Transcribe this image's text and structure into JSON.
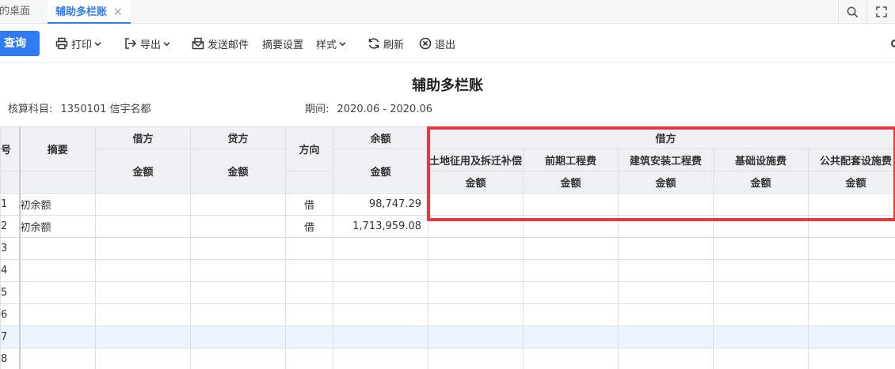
{
  "tabs": {
    "desktop": "我的桌面",
    "active": "辅助多栏账",
    "close": "×"
  },
  "toolbar": {
    "query": "查询",
    "print": "打印",
    "export": "导出",
    "send_mail": "发送邮件",
    "summary_settings": "摘要设置",
    "style": "样式",
    "refresh": "刷新",
    "exit": "退出"
  },
  "report": {
    "title": "辅助多栏账",
    "account_label": "核算科目:",
    "account_value": "1350101 信宇名都",
    "period_label": "期间:",
    "period_value": "2020.06 - 2020.06"
  },
  "table": {
    "headers": {
      "row_no": "号",
      "summary": "摘要",
      "debit": "借方",
      "credit": "贷方",
      "direction": "方向",
      "balance": "余额",
      "amount": "金额",
      "debit_group": "借方",
      "sub_columns": [
        "土地征用及拆迁补偿",
        "前期工程费",
        "建筑安装工程费",
        "基础设施费",
        "公共配套设施费"
      ]
    },
    "rows": [
      {
        "no": "1",
        "summary": "初余额",
        "debit": "",
        "credit": "",
        "direction": "借",
        "balance": "98,747.29"
      },
      {
        "no": "2",
        "summary": "初余额",
        "debit": "",
        "credit": "",
        "direction": "借",
        "balance": "1,713,959.08"
      },
      {
        "no": "3",
        "summary": "",
        "debit": "",
        "credit": "",
        "direction": "",
        "balance": ""
      },
      {
        "no": "4",
        "summary": "",
        "debit": "",
        "credit": "",
        "direction": "",
        "balance": ""
      },
      {
        "no": "5",
        "summary": "",
        "debit": "",
        "credit": "",
        "direction": "",
        "balance": ""
      },
      {
        "no": "6",
        "summary": "",
        "debit": "",
        "credit": "",
        "direction": "",
        "balance": ""
      },
      {
        "no": "7",
        "summary": "",
        "debit": "",
        "credit": "",
        "direction": "",
        "balance": ""
      },
      {
        "no": "8",
        "summary": "",
        "debit": "",
        "credit": "",
        "direction": "",
        "balance": ""
      }
    ]
  },
  "colors": {
    "accent": "#2f7bf2",
    "highlight_border": "#e8383d",
    "header_bg": "#eef0f3",
    "selected_row_bg": "#eef4fe"
  },
  "icons": [
    "search-icon",
    "fullscreen-icon",
    "printer-icon",
    "export-icon",
    "mail-icon",
    "refresh-icon",
    "exit-icon",
    "chevron-down-icon",
    "settings-icon"
  ]
}
